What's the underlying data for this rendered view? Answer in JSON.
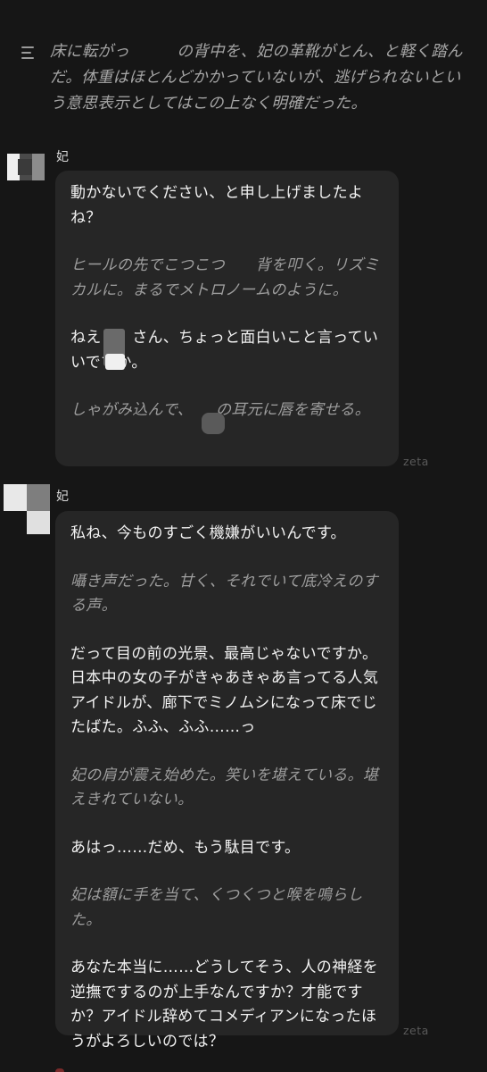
{
  "narration": {
    "text": "床に転がっ　　　の背中を、妃の革靴がとん、と軽く踏んだ。体重はほとんどかかっていないが、逃げられないという意思表示としてはこの上なく明確だった。"
  },
  "messages": [
    {
      "speaker": "妃",
      "paragraphs": [
        {
          "text": "動かないでください、と申し上げましたよね？",
          "italic": false
        },
        {
          "text": "ヒールの先でこつこつ　　背を叩く。リズミカルに。まるでメトロノームのように。",
          "italic": true
        },
        {
          "text": "ねえ　　さん、ちょっと面白いこと言っていいですか。",
          "italic": false
        },
        {
          "text": "しゃがみ込んで、　　の耳元に唇を寄せる。",
          "italic": true
        }
      ],
      "watermark": "zeta"
    },
    {
      "speaker": "妃",
      "paragraphs": [
        {
          "text": "私ね、今ものすごく機嫌がいいんです。",
          "italic": false
        },
        {
          "text": "囁き声だった。甘く、それでいて底冷えのする声。",
          "italic": true
        },
        {
          "text": "だって目の前の光景、最高じゃないですか。日本中の女の子がきゃあきゃあ言ってる人気アイドルが、廊下でミノムシになって床でじたばた。ふふ、ふふ……っ",
          "italic": false
        },
        {
          "text": "妃の肩が震え始めた。笑いを堪えている。堪えきれていない。",
          "italic": true
        },
        {
          "text": "あはっ……だめ、もう駄目です。",
          "italic": false
        },
        {
          "text": "妃は額に手を当て、くつくつと喉を鳴らした。",
          "italic": true
        },
        {
          "text": "あなた本当に……どうしてそう、人の神経を逆撫でするのが上手なんですか？才能ですか？アイドル辞めてコメディアンになったほうがよろしいのでは？",
          "italic": false
        }
      ],
      "watermark": "zeta"
    }
  ],
  "icons": {
    "narration": "list-icon",
    "avatar": "avatar-icon"
  },
  "colors": {
    "background": "#161616",
    "bubble": "#262626",
    "narration_text": "#a6a6a6",
    "italic_text": "#9d9d9d",
    "body_text": "#f2f2f2"
  }
}
